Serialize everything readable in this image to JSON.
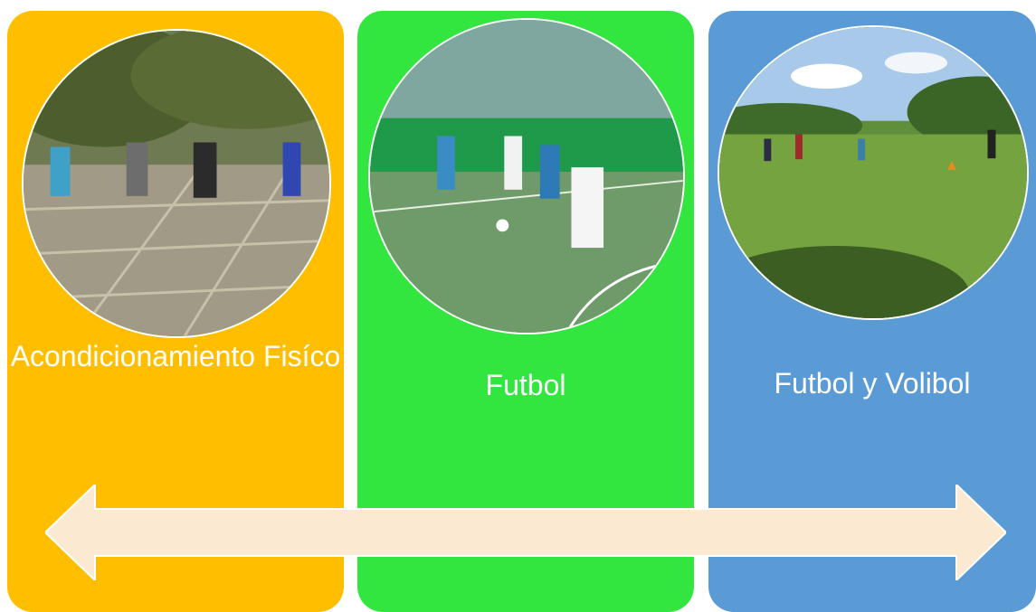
{
  "colors": {
    "panel_1": "#FFBF00",
    "panel_2": "#33E63F",
    "panel_3": "#5B9BD5",
    "arrow": "#FCE9D2"
  },
  "panels": [
    {
      "label": "Acondicionamiento Fisíco",
      "image": "outdoor-exercise-photo"
    },
    {
      "label": "Futbol",
      "image": "soccer-match-photo"
    },
    {
      "label": "Futbol y Volibol",
      "image": "grass-field-photo"
    }
  ],
  "arrow": {
    "icon": "double-arrow-icon"
  }
}
